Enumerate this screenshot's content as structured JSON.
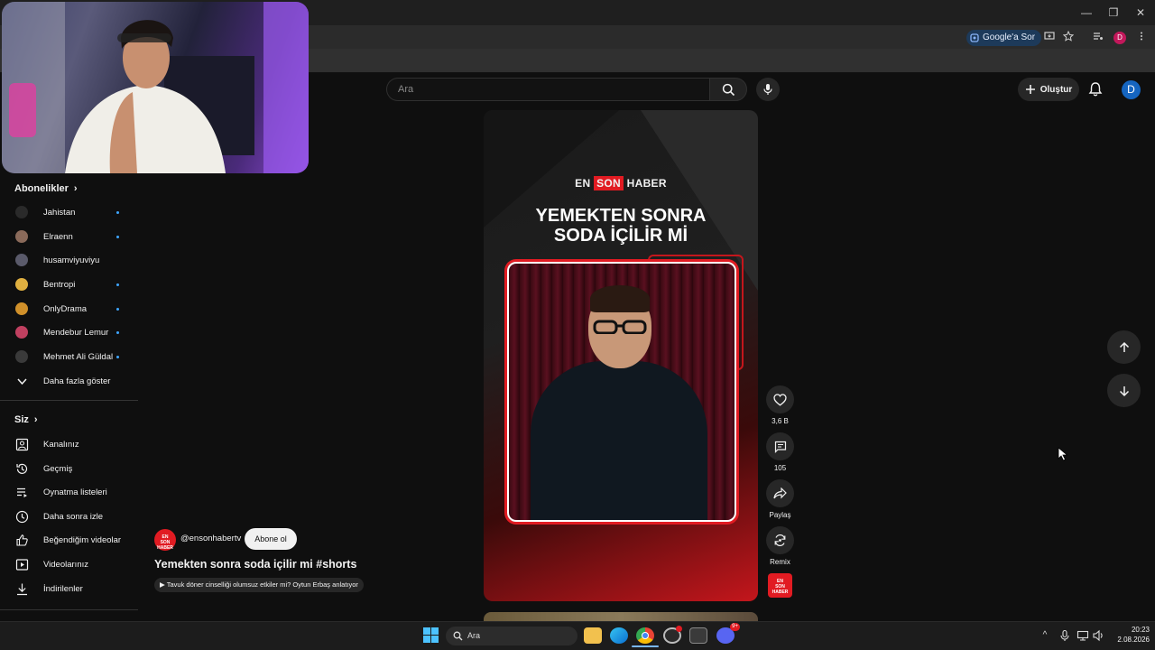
{
  "browser": {
    "google_ask_label": "Google'a Sor",
    "window_minimize": "—",
    "window_restore": "❐",
    "window_close": "✕"
  },
  "header": {
    "search_placeholder": "Ara",
    "create_label": "Oluştur",
    "avatar_letter": "D"
  },
  "sidebar": {
    "subscriptions_title": "Abonelikler",
    "subscriptions": [
      {
        "label": "Jahistan",
        "color": "#2a2a2a",
        "new": true
      },
      {
        "label": "Elraenn",
        "color": "#8a6a5a",
        "new": true
      },
      {
        "label": "husamviyuviyu",
        "color": "#5a5a6a",
        "new": false
      },
      {
        "label": "Bentropi",
        "color": "#e0b040",
        "new": true
      },
      {
        "label": "OnlyDrama",
        "color": "#d0902a",
        "new": true
      },
      {
        "label": "Mendebur Lemur",
        "color": "#c04060",
        "new": true
      },
      {
        "label": "Mehmet Ali Güldal",
        "color": "#3a3a3a",
        "new": true
      }
    ],
    "show_more_label": "Daha fazla göster",
    "you_title": "Siz",
    "you_items": [
      {
        "label": "Kanalınız",
        "icon": "channel-icon"
      },
      {
        "label": "Geçmiş",
        "icon": "history-icon"
      },
      {
        "label": "Oynatma listeleri",
        "icon": "playlists-icon"
      },
      {
        "label": "Daha sonra izle",
        "icon": "watch-later-icon"
      },
      {
        "label": "Beğendiğim videolar",
        "icon": "liked-icon"
      },
      {
        "label": "Videolarınız",
        "icon": "your-videos-icon"
      },
      {
        "label": "İndirilenler",
        "icon": "downloads-icon"
      }
    ]
  },
  "short": {
    "brand_en": "EN",
    "brand_son": "SON",
    "brand_haber": "HABER",
    "headline_line1": "YEMEKTEN SONRA",
    "headline_line2": "SODA İÇİLİR Mİ",
    "channel_handle": "@ensonhabertv",
    "subscribe_label": "Abone ol",
    "title": "Yemekten sonra soda içilir mi #shorts",
    "related_video": "Tavuk döner cinselliği olumsuz etkiler mi? Oytun Erbaş anlatıyor",
    "logo_text_1": "EN",
    "logo_text_2": "SON",
    "logo_text_3": "HABER"
  },
  "actions": {
    "likes": "3,6 B",
    "comments": "105",
    "share_label": "Paylaş",
    "remix_label": "Remix"
  },
  "taskbar": {
    "search_label": "Ara",
    "time": "20:23",
    "date": "2.08.2026",
    "discord_badge": "9+"
  },
  "colors": {
    "accent_red": "#e11b22",
    "link_blue": "#3ea6ff",
    "background": "#0f0f0f"
  }
}
